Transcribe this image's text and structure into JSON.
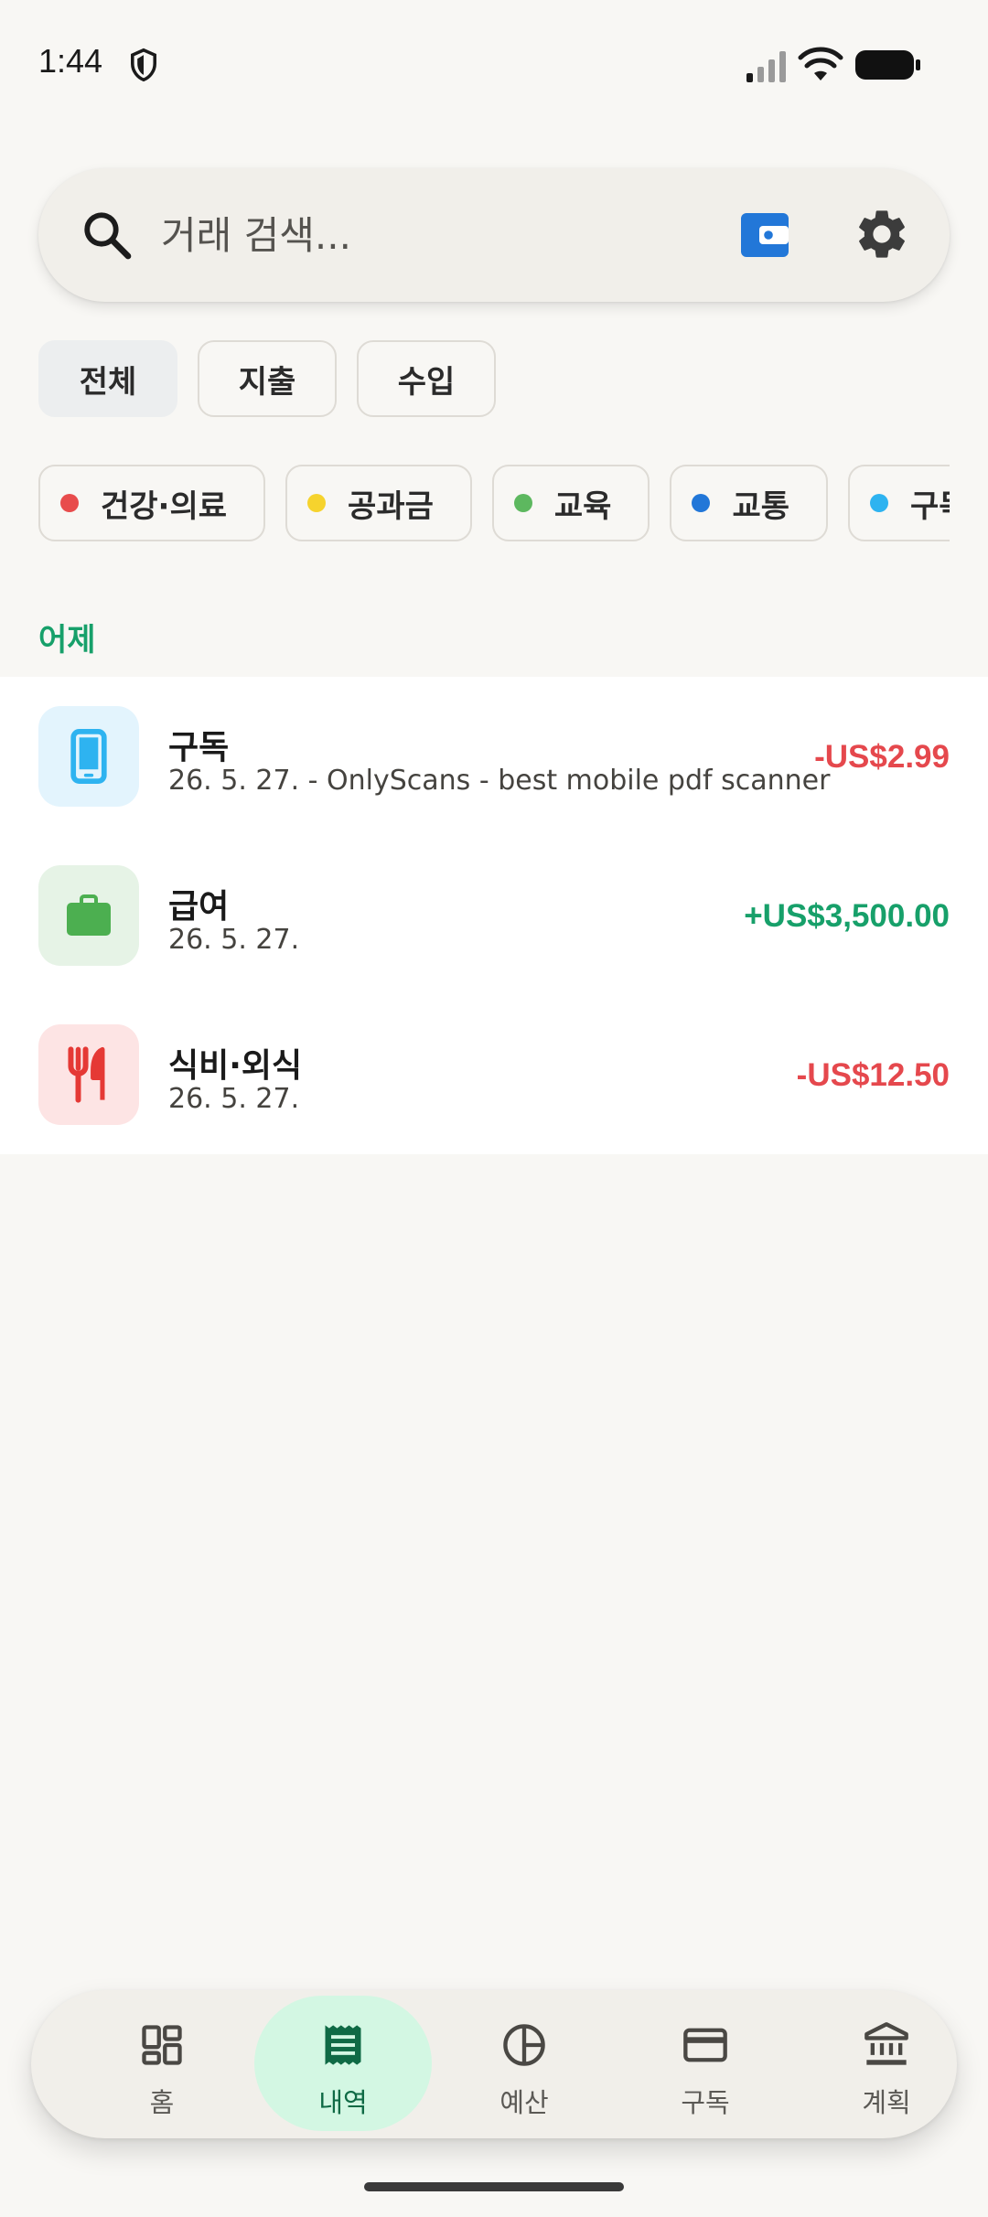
{
  "status_bar": {
    "time": "1:44"
  },
  "search": {
    "placeholder": "거래 검색..."
  },
  "type_filters": [
    {
      "label": "전체",
      "active": true
    },
    {
      "label": "지출",
      "active": false
    },
    {
      "label": "수입",
      "active": false
    }
  ],
  "categories": [
    {
      "label": "건강·의료",
      "color": "#e84c4c"
    },
    {
      "label": "공과금",
      "color": "#f6d32d"
    },
    {
      "label": "교육",
      "color": "#5db85f"
    },
    {
      "label": "교통",
      "color": "#2277d8"
    },
    {
      "label": "구독",
      "color": "#2eb3f0"
    }
  ],
  "section": {
    "header": "어제"
  },
  "transactions": [
    {
      "title": "구독",
      "subtitle": "26. 5. 27. - OnlyScans - best mobile pdf scanner",
      "amount": "-US$2.99",
      "icon": "phone-icon",
      "amount_color": "#e5484d",
      "icon_bg": "#e3f4fd",
      "icon_color": "#2eb3f0"
    },
    {
      "title": "급여",
      "subtitle": "26. 5. 27.",
      "amount": "+US$3,500.00",
      "icon": "briefcase-icon",
      "amount_color": "#17a06a",
      "icon_bg": "#e6f3e6",
      "icon_color": "#4caf50"
    },
    {
      "title": "식비·외식",
      "subtitle": "26. 5. 27.",
      "amount": "-US$12.50",
      "icon": "cutlery-icon",
      "amount_color": "#e5484d",
      "icon_bg": "#fde4e4",
      "icon_color": "#e53935"
    }
  ],
  "bottom_nav": [
    {
      "label": "홈",
      "icon": "dashboard-icon",
      "active": false
    },
    {
      "label": "내역",
      "icon": "receipt-icon",
      "active": true
    },
    {
      "label": "예산",
      "icon": "pie-chart-icon",
      "active": false
    },
    {
      "label": "구독",
      "icon": "credit-card-icon",
      "active": false
    },
    {
      "label": "계획",
      "icon": "bank-icon",
      "active": false
    }
  ],
  "colors": {
    "accent": "#17a06a",
    "expense": "#e5484d",
    "nav_active_bg": "#d3f7e3",
    "wallet_blue": "#2277d8"
  }
}
